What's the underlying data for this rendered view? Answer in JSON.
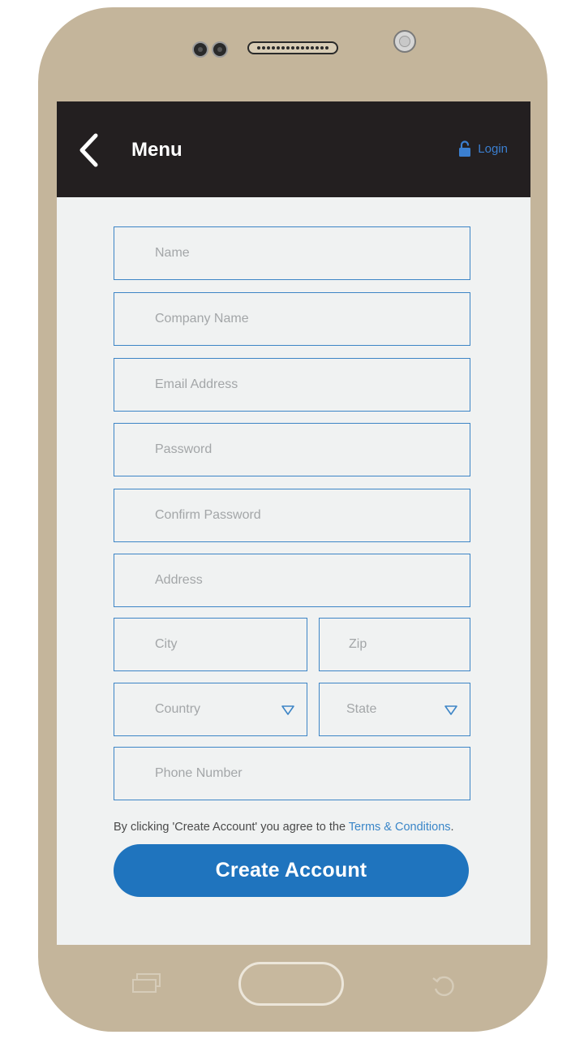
{
  "header": {
    "title": "Menu",
    "login_label": "Login"
  },
  "form": {
    "name_placeholder": "Name",
    "company_placeholder": "Company Name",
    "email_placeholder": "Email Address",
    "password_placeholder": "Password",
    "confirm_password_placeholder": "Confirm Password",
    "address_placeholder": "Address",
    "city_placeholder": "City",
    "zip_placeholder": "Zip",
    "country_label": "Country",
    "state_label": "State",
    "phone_placeholder": "Phone Number"
  },
  "terms": {
    "prefix": "By clicking 'Create Account' you agree to the ",
    "link": "Terms & Conditions",
    "suffix": "."
  },
  "actions": {
    "create_label": "Create Account"
  },
  "colors": {
    "accent": "#1f74be",
    "field_border": "#3d85c6",
    "header_bg": "#231f20",
    "phone_body": "#c4b59b"
  },
  "icons": {
    "back": "chevron-left-icon",
    "login": "unlock-icon",
    "dropdown": "triangle-down-icon"
  }
}
